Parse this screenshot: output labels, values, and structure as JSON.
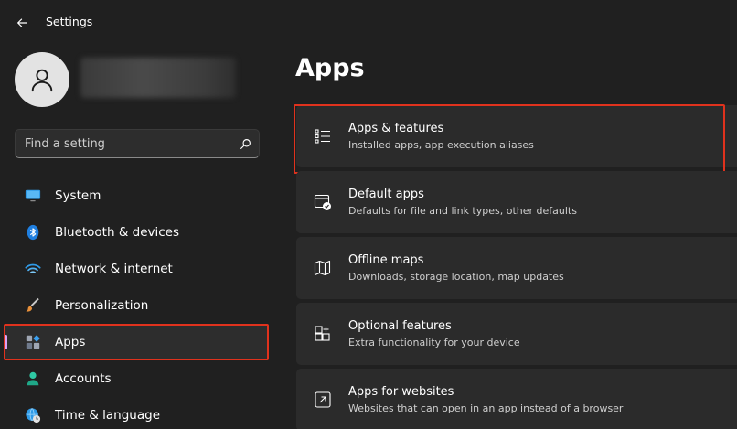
{
  "window": {
    "title": "Settings"
  },
  "sidebar": {
    "search": {
      "placeholder": "Find a setting",
      "value": ""
    },
    "items": [
      {
        "label": "System",
        "icon": "monitor-icon",
        "active": false
      },
      {
        "label": "Bluetooth & devices",
        "icon": "bluetooth-icon",
        "active": false
      },
      {
        "label": "Network & internet",
        "icon": "wifi-icon",
        "active": false
      },
      {
        "label": "Personalization",
        "icon": "brush-icon",
        "active": false
      },
      {
        "label": "Apps",
        "icon": "apps-icon",
        "active": true
      },
      {
        "label": "Accounts",
        "icon": "person-icon",
        "active": false
      },
      {
        "label": "Time & language",
        "icon": "globe-clock-icon",
        "active": false
      }
    ]
  },
  "main": {
    "title": "Apps",
    "cards": [
      {
        "title": "Apps & features",
        "subtitle": "Installed apps, app execution aliases",
        "icon": "list-icon",
        "highlighted": true
      },
      {
        "title": "Default apps",
        "subtitle": "Defaults for file and link types, other defaults",
        "icon": "default-apps-icon",
        "highlighted": false
      },
      {
        "title": "Offline maps",
        "subtitle": "Downloads, storage location, map updates",
        "icon": "map-icon",
        "highlighted": false
      },
      {
        "title": "Optional features",
        "subtitle": "Extra functionality for your device",
        "icon": "grid-plus-icon",
        "highlighted": false
      },
      {
        "title": "Apps for websites",
        "subtitle": "Websites that can open in an app instead of a browser",
        "icon": "open-external-icon",
        "highlighted": false
      }
    ]
  },
  "colors": {
    "background": "#202020",
    "card": "#2b2b2b",
    "accent_indicator": "#d9a3f5",
    "highlight_border": "#e0321d"
  }
}
